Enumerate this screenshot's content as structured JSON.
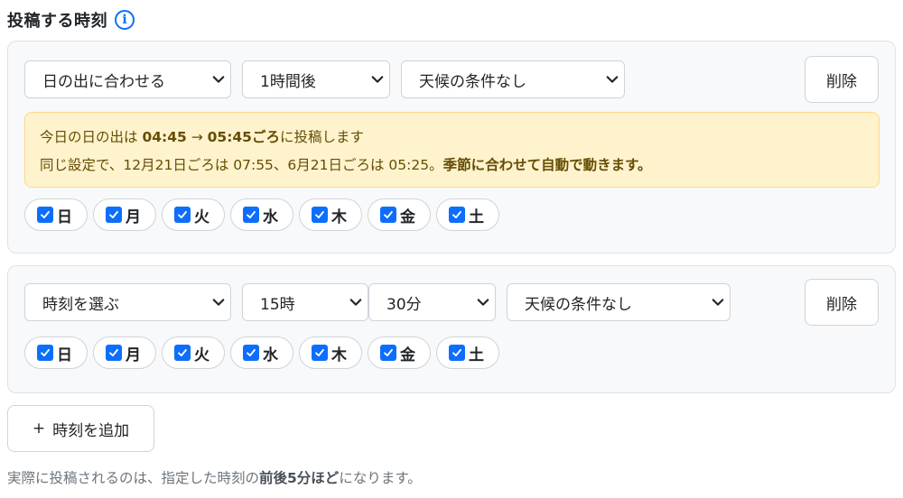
{
  "header": {
    "title": "投稿する時刻",
    "info_icon": "i"
  },
  "schedule1": {
    "mode": "日の出に合わせる",
    "offset": "1時間後",
    "weather": "天候の条件なし",
    "delete_label": "削除",
    "notice": {
      "l1_prefix": "今日の日の出は ",
      "sunrise": "04:45",
      "arrow": " → ",
      "post_time": "05:45ごろ",
      "l1_suffix": "に投稿します",
      "l2_text": "同じ設定で、12月21日ごろは 07:55、6月21日ごろは 05:25。",
      "l2_bold": "季節に合わせて自動で動きます。"
    },
    "days": [
      {
        "label": "日",
        "checked": true
      },
      {
        "label": "月",
        "checked": true
      },
      {
        "label": "火",
        "checked": true
      },
      {
        "label": "水",
        "checked": true
      },
      {
        "label": "木",
        "checked": true
      },
      {
        "label": "金",
        "checked": true
      },
      {
        "label": "土",
        "checked": true
      }
    ]
  },
  "schedule2": {
    "mode": "時刻を選ぶ",
    "hour": "15時",
    "minute": "30分",
    "weather": "天候の条件なし",
    "delete_label": "削除",
    "days": [
      {
        "label": "日",
        "checked": true
      },
      {
        "label": "月",
        "checked": true
      },
      {
        "label": "火",
        "checked": true
      },
      {
        "label": "水",
        "checked": true
      },
      {
        "label": "木",
        "checked": true
      },
      {
        "label": "金",
        "checked": true
      },
      {
        "label": "土",
        "checked": true
      }
    ]
  },
  "add_button": {
    "plus": "+",
    "label": "時刻を追加"
  },
  "footnote": {
    "prefix": "実際に投稿されるのは、指定した時刻の",
    "bold": "前後5分ほど",
    "suffix": "になります。"
  },
  "colors": {
    "accent": "#0d6efd",
    "notice_bg": "#fff3cd",
    "notice_text": "#664d03"
  },
  "icons": {
    "info": "info-circle-icon",
    "chevron": "chevron-down-icon",
    "check": "checkmark-icon",
    "plus": "plus-icon"
  }
}
